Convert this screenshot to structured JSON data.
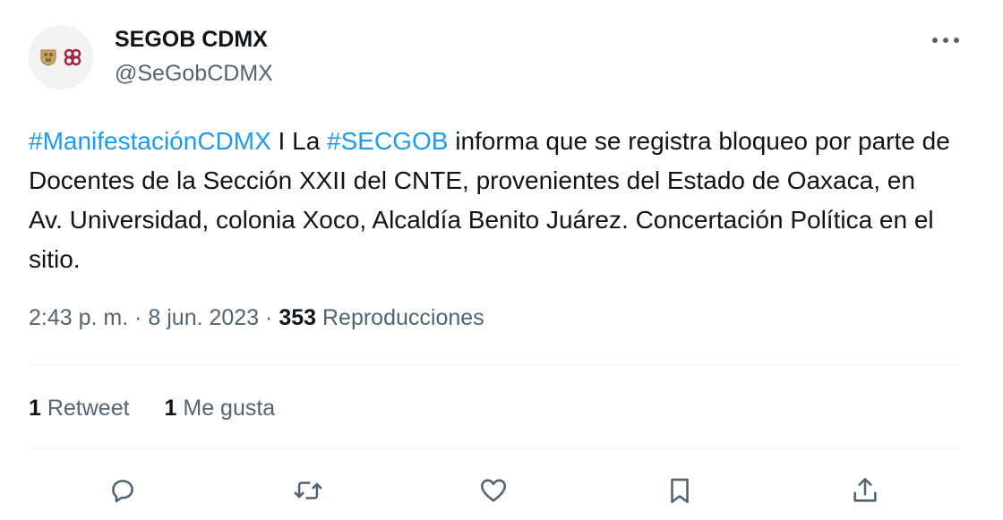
{
  "author": {
    "name": "SEGOB CDMX",
    "handle": "@SeGobCDMX",
    "avatar_icon": "cdmx-government-logo"
  },
  "more_icon": "more-horizontal-icon",
  "tweet": {
    "hashtag1": "#ManifestaciónCDMX",
    "text1": " I La ",
    "hashtag2": "#SECGOB",
    "text2": " informa que se registra bloqueo por parte de Docentes de la Sección XXII del CNTE, provenientes del Estado de Oaxaca, en Av. Universidad, colonia Xoco, Alcaldía Benito Juárez. Concertación Política en el sitio."
  },
  "meta": {
    "time": "2:43 p. m.",
    "sep1": " · ",
    "date": "8 jun. 2023",
    "sep2": " · ",
    "views_count": "353",
    "views_label": " Reproducciones"
  },
  "stats": {
    "retweets_count": "1",
    "retweets_label": " Retweet",
    "likes_count": "1",
    "likes_label": " Me gusta"
  },
  "colors": {
    "link": "#1d9bf0",
    "secondary_text": "#536471",
    "primary_text": "#0f1419",
    "divider": "#eff3f4"
  },
  "actions": [
    "reply-icon",
    "retweet-icon",
    "like-icon",
    "bookmark-icon",
    "share-icon"
  ]
}
